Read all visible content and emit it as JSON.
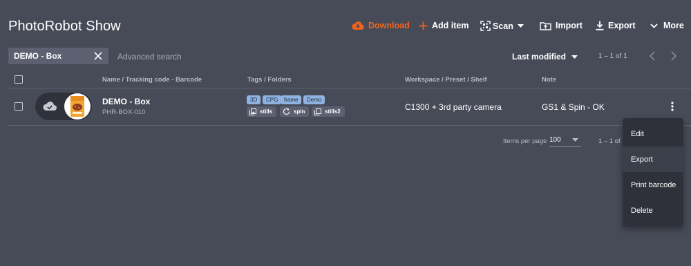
{
  "app": {
    "title": "PhotoRobot Show"
  },
  "toolbar": {
    "download": "Download",
    "add_item": "Add item",
    "scan": "Scan",
    "import": "Import",
    "export": "Export",
    "more": "More",
    "accent_color": "#f0641e"
  },
  "search": {
    "chip": "DEMO - Box",
    "advanced": "Advanced search"
  },
  "sort": {
    "label": "Last modified"
  },
  "pagination": {
    "top": "1 – 1 of 1",
    "items_per_page_label": "Items per page",
    "items_per_page": "100",
    "bottom": "1 – 1 of"
  },
  "columns": {
    "name": "Name / Tracking code - Barcode",
    "tags": "Tags / Folders",
    "workspace": "Workspace / Preset / Shelf",
    "note": "Note"
  },
  "rows": [
    {
      "name": "DEMO - Box",
      "code": "PHR-BOX-010",
      "tags": [
        "3D",
        "CPG",
        "frame",
        "Demo"
      ],
      "folders": [
        {
          "icon": "image-stack-icon",
          "label": "stills"
        },
        {
          "icon": "rotate-icon",
          "label": "spin"
        },
        {
          "icon": "image-stack-icon",
          "label": "stills2"
        }
      ],
      "workspace": "C1300 + 3rd party camera",
      "note": "GS1 & Spin - OK",
      "status_icon": "cloud-check-icon"
    }
  ],
  "context_menu": {
    "items": [
      "Edit",
      "Export",
      "Print barcode",
      "Delete"
    ]
  }
}
